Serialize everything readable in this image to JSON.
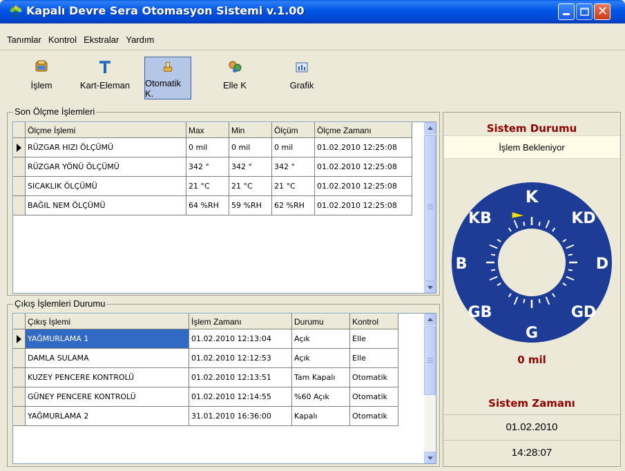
{
  "window": {
    "title": "Kapalı Devre Sera Otomasyon Sistemi v.1.00"
  },
  "menu": [
    {
      "label": "Tanımlar"
    },
    {
      "label": "Kontrol"
    },
    {
      "label": "Ekstralar"
    },
    {
      "label": "Yardım"
    }
  ],
  "toolbar": [
    {
      "label": "İşlem",
      "icon": "process-icon"
    },
    {
      "label": "Kart-Eleman",
      "icon": "card-element-icon"
    },
    {
      "label": "Otomatik K.",
      "icon": "auto-control-icon",
      "active": true
    },
    {
      "label": "Elle K",
      "icon": "manual-control-icon"
    },
    {
      "label": "Grafik",
      "icon": "chart-icon"
    }
  ],
  "measurements": {
    "group_label": "Son Ölçme İşlemleri",
    "columns": [
      "Ölçme İşlemi",
      "Max",
      "Min",
      "Ölçüm",
      "Ölçme Zamanı"
    ],
    "rows": [
      [
        "RÜZGAR HIZI ÖLÇÜMÜ",
        "0 mil",
        "0 mil",
        "0 mil",
        "01.02.2010 12:25:08"
      ],
      [
        "RÜZGAR YÖNÜ ÖLÇÜMÜ",
        "342 °",
        "342 °",
        "342 °",
        "01.02.2010 12:25:08"
      ],
      [
        "SICAKLIK ÖLÇÜMÜ",
        "21 °C",
        "21 °C",
        "21 °C",
        "01.02.2010 12:25:08"
      ],
      [
        "BAĞIL NEM ÖLÇÜMÜ",
        "64 %RH",
        "59 %RH",
        "62 %RH",
        "01.02.2010 12:25:08"
      ]
    ]
  },
  "outputs": {
    "group_label": "Çıkış İşlemleri Durumu",
    "columns": [
      "Çıkış İşlemi",
      "İşlem Zamanı",
      "Durumu",
      "Kontrol"
    ],
    "rows": [
      [
        "YAĞMURLAMA 1",
        "01.02.2010 12:13:04",
        "Açık",
        "Elle"
      ],
      [
        "DAMLA SULAMA",
        "01.02.2010 12:12:53",
        "Açık",
        "Elle"
      ],
      [
        "KUZEY PENCERE KONTROLÜ",
        "01.02.2010 12:13:51",
        "Tam Kapalı",
        "Otomatik"
      ],
      [
        "GÜNEY PENCERE KONTROLÜ",
        "01.02.2010 12:14:55",
        "%60 Açık",
        "Otomatik"
      ],
      [
        "YAĞMURLAMA 2",
        "31.01.2010 16:36:00",
        "Kapalı",
        "Otomatik"
      ]
    ]
  },
  "system": {
    "status_title": "Sistem Durumu",
    "status_text": "İşlem Bekleniyor",
    "compass_labels": {
      "n": "K",
      "ne": "KD",
      "e": "D",
      "se": "GD",
      "s": "G",
      "sw": "GB",
      "w": "B",
      "nw": "KB"
    },
    "wind_direction_deg": 342,
    "wind_speed": "0 mil",
    "time_title": "Sistem Zamanı",
    "date": "01.02.2010",
    "time": "14:28:07"
  },
  "colors": {
    "compass_fill": "#1c3c96",
    "title_red": "#8b0000",
    "selection": "#316ac5"
  }
}
